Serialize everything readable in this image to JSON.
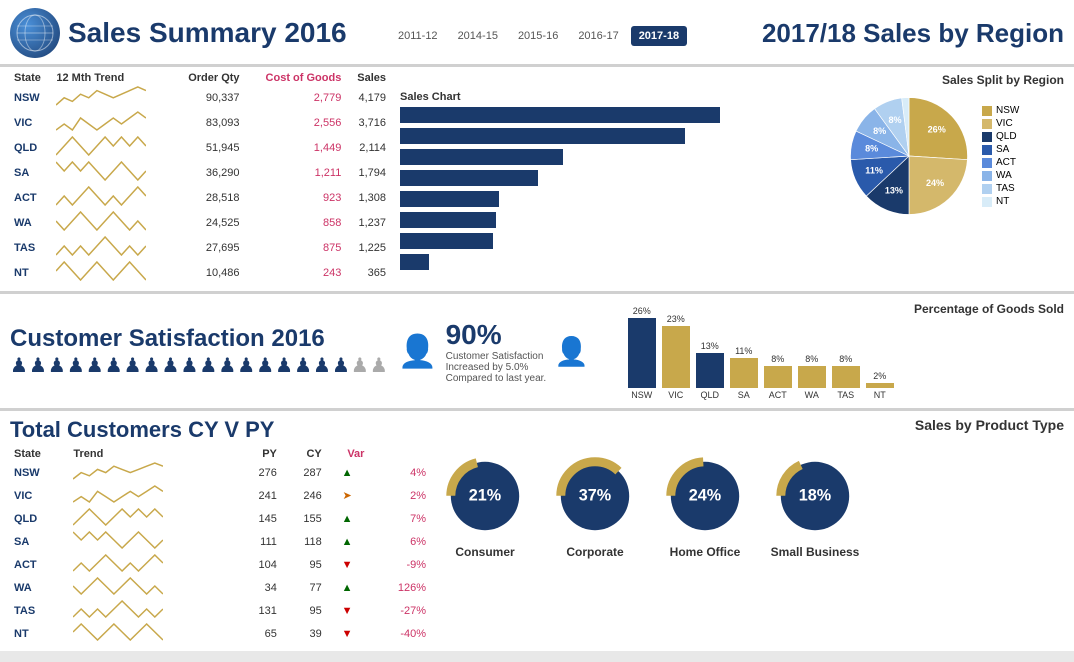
{
  "header": {
    "title": "Sales Summary 2016",
    "right_title": "2017/18 Sales by Region",
    "year_tabs": [
      "2011-12",
      "2014-15",
      "2015-16",
      "2016-17",
      "2017-18"
    ],
    "active_tab": "2017-18"
  },
  "sales_table": {
    "columns": [
      "State",
      "12 Mth Trend",
      "Order Qty",
      "Cost of Goods",
      "Sales"
    ],
    "chart_title": "Sales Chart",
    "rows": [
      {
        "state": "NSW",
        "order_qty": "90,337",
        "cost": "2,779",
        "sales": "4,179",
        "bar_pct": 100
      },
      {
        "state": "VIC",
        "order_qty": "83,093",
        "cost": "2,556",
        "sales": "3,716",
        "bar_pct": 89
      },
      {
        "state": "QLD",
        "order_qty": "51,945",
        "cost": "1,449",
        "sales": "2,114",
        "bar_pct": 51
      },
      {
        "state": "SA",
        "order_qty": "36,290",
        "cost": "1,211",
        "sales": "1,794",
        "bar_pct": 43
      },
      {
        "state": "ACT",
        "order_qty": "28,518",
        "cost": "923",
        "sales": "1,308",
        "bar_pct": 31
      },
      {
        "state": "WA",
        "order_qty": "24,525",
        "cost": "858",
        "sales": "1,237",
        "bar_pct": 30
      },
      {
        "state": "TAS",
        "order_qty": "27,695",
        "cost": "875",
        "sales": "1,225",
        "bar_pct": 29
      },
      {
        "state": "NT",
        "order_qty": "10,486",
        "cost": "243",
        "sales": "365",
        "bar_pct": 9
      }
    ]
  },
  "pie_chart": {
    "title": "Sales Split by Region",
    "segments": [
      {
        "label": "NSW",
        "pct": 26,
        "color": "#c8a84b"
      },
      {
        "label": "VIC",
        "pct": 24,
        "color": "#d4b86b"
      },
      {
        "label": "QLD",
        "pct": 13,
        "color": "#1a3a6b"
      },
      {
        "label": "SA",
        "pct": 11,
        "color": "#2a5aab"
      },
      {
        "label": "ACT",
        "pct": 8,
        "color": "#5a8adb"
      },
      {
        "label": "WA",
        "pct": 8,
        "color": "#8ab4e8"
      },
      {
        "label": "TAS",
        "pct": 8,
        "color": "#b0d0f0"
      },
      {
        "label": "NT",
        "pct": 2,
        "color": "#d8ecf8"
      }
    ]
  },
  "customer_satisfaction": {
    "title": "Customer Satisfaction 2016",
    "percentage": "90%",
    "description": "Customer Satisfaction\nIncreased by 5.0%\nCompared to last year.",
    "filled_persons": 18,
    "total_persons": 20
  },
  "goods_sold": {
    "title": "Percentage of Goods Sold",
    "bars": [
      {
        "label": "NSW",
        "pct": 26,
        "color": "#1a3a6b"
      },
      {
        "label": "VIC",
        "pct": 23,
        "color": "#c8a84b"
      },
      {
        "label": "QLD",
        "pct": 13,
        "color": "#1a3a6b"
      },
      {
        "label": "SA",
        "pct": 11,
        "color": "#c8a84b"
      },
      {
        "label": "ACT",
        "pct": 8,
        "color": "#c8a84b"
      },
      {
        "label": "WA",
        "pct": 8,
        "color": "#c8a84b"
      },
      {
        "label": "TAS",
        "pct": 8,
        "color": "#c8a84b"
      },
      {
        "label": "NT",
        "pct": 2,
        "color": "#c8a84b"
      }
    ]
  },
  "customers_table": {
    "title": "Total Customers CY V PY",
    "columns": [
      "State",
      "Trend",
      "PY",
      "CY",
      "Var"
    ],
    "rows": [
      {
        "state": "NSW",
        "py": "276",
        "cy": "287",
        "var": "4%",
        "arrow": "up"
      },
      {
        "state": "VIC",
        "py": "241",
        "cy": "246",
        "var": "2%",
        "arrow": "side"
      },
      {
        "state": "QLD",
        "py": "145",
        "cy": "155",
        "var": "7%",
        "arrow": "up"
      },
      {
        "state": "SA",
        "py": "111",
        "cy": "118",
        "var": "6%",
        "arrow": "up"
      },
      {
        "state": "ACT",
        "py": "104",
        "cy": "95",
        "var": "-9%",
        "arrow": "down"
      },
      {
        "state": "WA",
        "py": "34",
        "cy": "77",
        "var": "126%",
        "arrow": "up"
      },
      {
        "state": "TAS",
        "py": "131",
        "cy": "95",
        "var": "-27%",
        "arrow": "down"
      },
      {
        "state": "NT",
        "py": "65",
        "cy": "39",
        "var": "-40%",
        "arrow": "down"
      }
    ]
  },
  "product_types": {
    "title": "Sales by Product Type",
    "items": [
      {
        "label": "Consumer",
        "pct": 21,
        "pct_label": "21%"
      },
      {
        "label": "Corporate",
        "pct": 37,
        "pct_label": "37%"
      },
      {
        "label": "Home Office",
        "pct": 24,
        "pct_label": "24%"
      },
      {
        "label": "Small Business",
        "pct": 18,
        "pct_label": "18%"
      }
    ]
  },
  "colors": {
    "dark_blue": "#1a3a6b",
    "gold": "#c8a84b",
    "pink": "#cc3366",
    "light_blue": "#5a8adb"
  }
}
